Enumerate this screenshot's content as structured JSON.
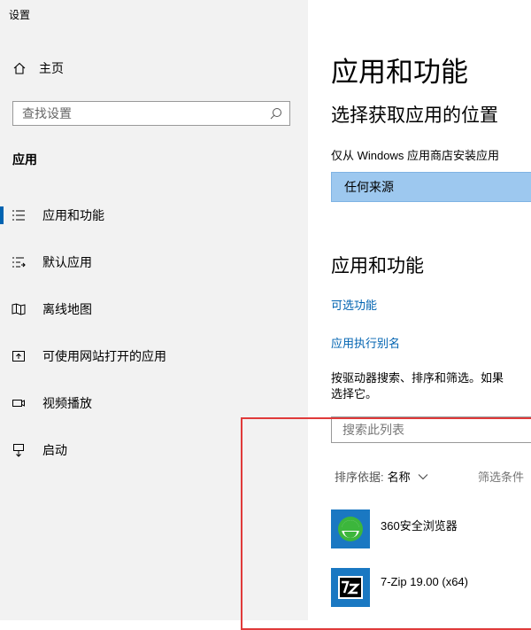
{
  "window": {
    "title": "设置"
  },
  "sidebar": {
    "home_label": "主页",
    "search_placeholder": "查找设置",
    "section_title": "应用",
    "items": [
      {
        "label": "应用和功能",
        "icon": "apps-features-icon",
        "selected": true
      },
      {
        "label": "默认应用",
        "icon": "default-apps-icon",
        "selected": false
      },
      {
        "label": "离线地图",
        "icon": "offline-maps-icon",
        "selected": false
      },
      {
        "label": "可使用网站打开的应用",
        "icon": "apps-for-websites-icon",
        "selected": false
      },
      {
        "label": "视频播放",
        "icon": "video-playback-icon",
        "selected": false
      },
      {
        "label": "启动",
        "icon": "startup-icon",
        "selected": false
      }
    ]
  },
  "main": {
    "page_title": "应用和功能",
    "install_section": {
      "title": "选择获取应用的位置",
      "description": "仅从 Windows 应用商店安装应用",
      "dropdown_value": "任何来源"
    },
    "apps_section": {
      "title": "应用和功能",
      "link_optional": "可选功能",
      "link_alias": "应用执行别名",
      "description_line1": "按驱动器搜索、排序和筛选。如果",
      "description_line2": "选择它。",
      "search_placeholder": "搜索此列表",
      "sort_label": "排序依据:",
      "sort_value": "名称",
      "filter_label": "筛选条件",
      "apps": [
        {
          "name": "360安全浏览器",
          "icon": "360-browser-icon"
        },
        {
          "name": "7-Zip 19.00 (x64)",
          "icon": "7zip-icon"
        }
      ]
    }
  },
  "colors": {
    "accent": "#0063b1",
    "sidebar_bg": "#f2f2f2",
    "dropdown_bg": "#9dc8ef",
    "highlight_box": "#e03a3a"
  }
}
